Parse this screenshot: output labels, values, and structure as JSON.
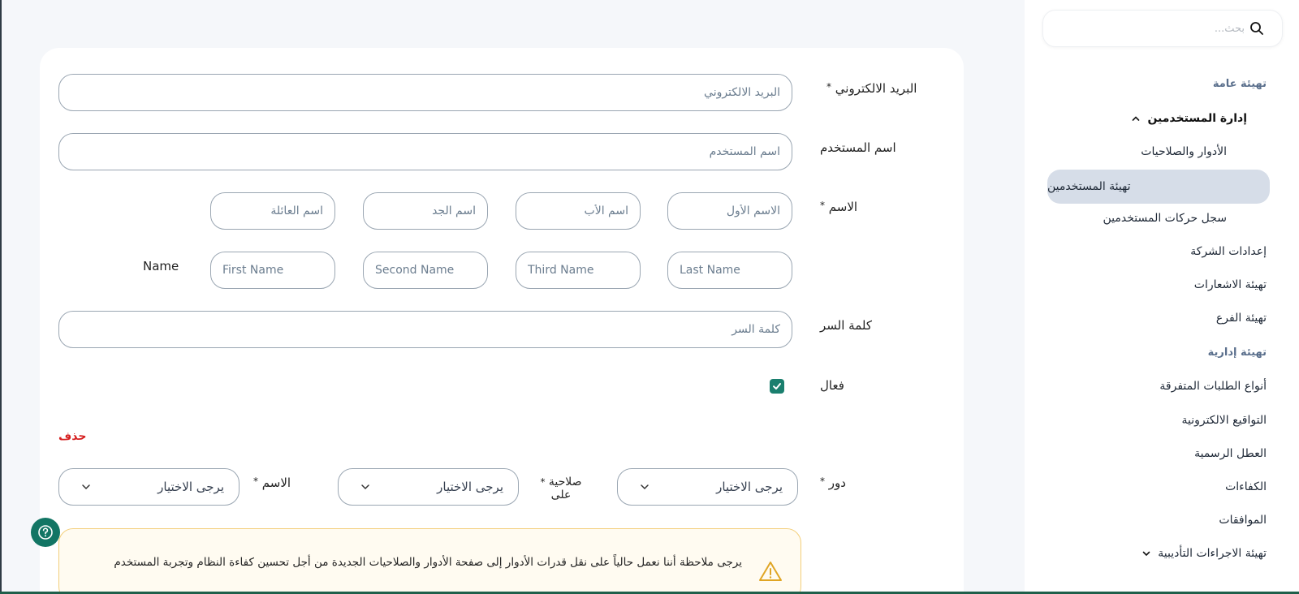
{
  "sidebar": {
    "search_placeholder": "بحث...",
    "sections": {
      "general_title": "تهيئة عامة",
      "admin_title": "تهيئة إدارية"
    },
    "user_management": "إدارة المستخدمين",
    "items": {
      "roles": "الأدوار والصلاحيات",
      "user_setup": "تهيئة المستخدمين",
      "user_log": "سجل حركات المستخدمين",
      "company": "إعدادات الشركة",
      "notifications": "تهيئة الاشعارات",
      "branch": "تهيئة الفرع",
      "request_types": "أنواع الطلبات المتفرقة",
      "e_signatures": "التواقيع الالكترونية",
      "holidays": "العطل الرسمية",
      "competencies": "الكفاءات",
      "approvals": "الموافقات",
      "disciplinary": "تهيئة الاجراءات التأديبية"
    }
  },
  "form": {
    "email": {
      "label": "البريد الالكتروني",
      "required": "*",
      "placeholder": "البريد الالكتروني"
    },
    "username": {
      "label": "اسم المستخدم",
      "placeholder": "اسم المستخدم"
    },
    "name": {
      "label": "الاسم",
      "required": "*",
      "ar": {
        "first": "الاسم الأول",
        "father": "اسم الأب",
        "grandfather": "اسم الجد",
        "family": "اسم العائلة"
      },
      "en_label": "Name",
      "en": {
        "last": "Last Name",
        "third": "Third Name",
        "second": "Second Name",
        "first": "First Name"
      }
    },
    "password": {
      "label": "كلمة السر",
      "placeholder": "كلمة السر"
    },
    "active": {
      "label": "فعال",
      "checked": true
    },
    "delete_label": "حذف",
    "role_row": {
      "role_label": "دور",
      "role_required": "*",
      "role_value": "يرجى الاختيار",
      "permission_label_1": "صلاحية",
      "permission_label_2": "على",
      "permission_required": "*",
      "permission_value": "يرجى الاختيار",
      "name_label": "الاسم",
      "name_required": "*",
      "name_value": "يرجى الاختيار"
    },
    "notice_text": "يرجى ملاحظة أننا نعمل حالياً على نقل قدرات الأدوار إلى صفحة الأدوار والصلاحيات الجديدة من أجل تحسين كفاءة النظام وتجربة المستخدم"
  },
  "colors": {
    "accent": "#1a7f6e",
    "active_nav_bg": "#d6dde8",
    "danger": "#d61f1f",
    "notice_bg": "#fffbf1",
    "notice_border": "#f3cf7b"
  }
}
